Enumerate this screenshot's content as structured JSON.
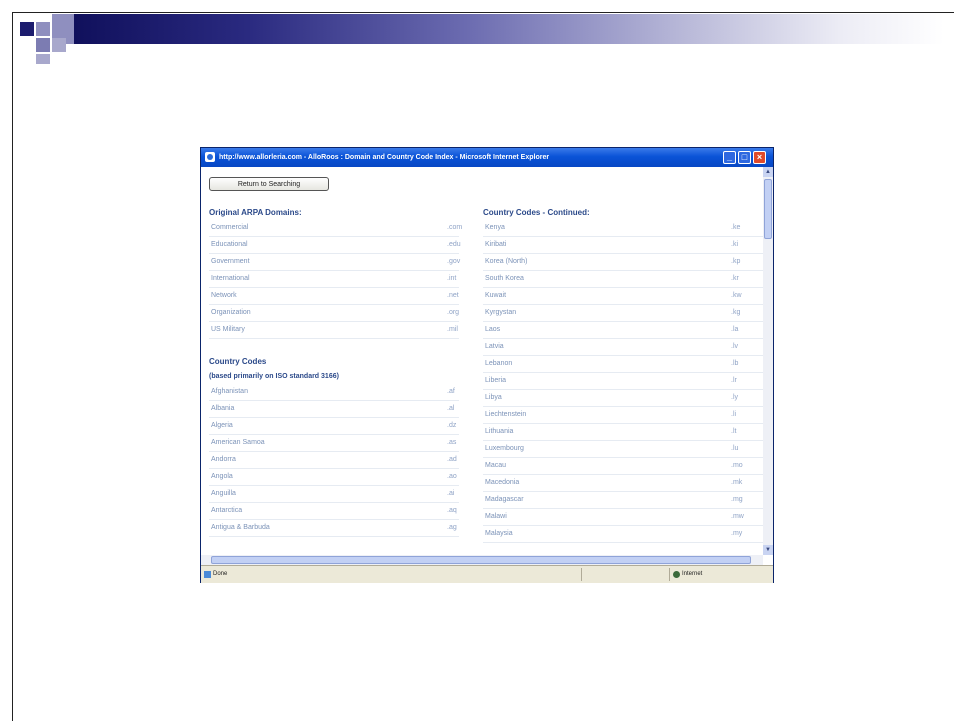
{
  "window": {
    "title": "http://www.allorleria.com - AlloRoos : Domain and Country Code Index - Microsoft Internet Explorer",
    "button_min": "_",
    "button_max": "□",
    "button_close": "×"
  },
  "page": {
    "return_button": "Return to Searching"
  },
  "left": {
    "arpa_heading": "Original ARPA Domains:",
    "arpa": [
      {
        "name": "Commercial",
        "code": ".com"
      },
      {
        "name": "Educational",
        "code": ".edu"
      },
      {
        "name": "Government",
        "code": ".gov"
      },
      {
        "name": "International",
        "code": ".int"
      },
      {
        "name": "Network",
        "code": ".net"
      },
      {
        "name": "Organization",
        "code": ".org"
      },
      {
        "name": "US Military",
        "code": ".mil"
      }
    ],
    "cc_heading": "Country Codes",
    "cc_subheading": "(based primarily on ISO standard 3166)",
    "countries": [
      {
        "name": "Afghanistan",
        "code": ".af"
      },
      {
        "name": "Albania",
        "code": ".al"
      },
      {
        "name": "Algeria",
        "code": ".dz"
      },
      {
        "name": "American Samoa",
        "code": ".as"
      },
      {
        "name": "Andorra",
        "code": ".ad"
      },
      {
        "name": "Angola",
        "code": ".ao"
      },
      {
        "name": "Anguilla",
        "code": ".ai"
      },
      {
        "name": "Antarctica",
        "code": ".aq"
      },
      {
        "name": "Antigua & Barbuda",
        "code": ".ag"
      }
    ]
  },
  "right": {
    "heading": "Country Codes - Continued:",
    "countries": [
      {
        "name": "Kenya",
        "code": ".ke"
      },
      {
        "name": "Kiribati",
        "code": ".ki"
      },
      {
        "name": "Korea (North)",
        "code": ".kp"
      },
      {
        "name": "South Korea",
        "code": ".kr"
      },
      {
        "name": "Kuwait",
        "code": ".kw"
      },
      {
        "name": "Kyrgystan",
        "code": ".kg"
      },
      {
        "name": "Laos",
        "code": ".la"
      },
      {
        "name": "Latvia",
        "code": ".lv"
      },
      {
        "name": "Lebanon",
        "code": ".lb"
      },
      {
        "name": "Liberia",
        "code": ".lr"
      },
      {
        "name": "Libya",
        "code": ".ly"
      },
      {
        "name": "Liechtenstein",
        "code": ".li"
      },
      {
        "name": "Lithuania",
        "code": ".lt"
      },
      {
        "name": "Luxembourg",
        "code": ".lu"
      },
      {
        "name": "Macau",
        "code": ".mo"
      },
      {
        "name": "Macedonia",
        "code": ".mk"
      },
      {
        "name": "Madagascar",
        "code": ".mg"
      },
      {
        "name": "Malawi",
        "code": ".mw"
      },
      {
        "name": "Malaysia",
        "code": ".my"
      }
    ]
  },
  "status": {
    "left": "Done",
    "right": "Internet"
  },
  "colors": {
    "link": "#7c93b8",
    "heading": "#2c4a8a",
    "titlebar": "#0a53d7"
  },
  "icons": [
    "ie-page-icon",
    "minimize-icon",
    "maximize-icon",
    "close-icon",
    "done-page-icon",
    "internet-zone-icon"
  ]
}
